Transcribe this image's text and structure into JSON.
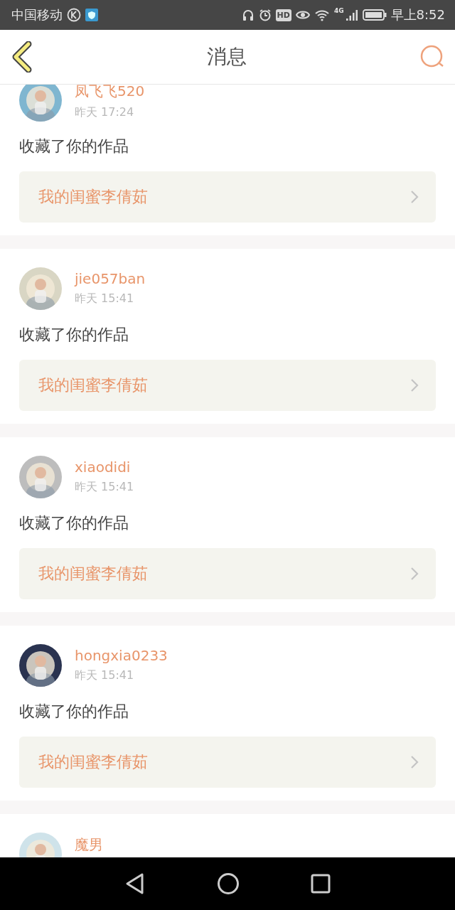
{
  "status_bar": {
    "carrier": "中国移动",
    "hd": "HD",
    "network": "4G",
    "time": "早上8:52"
  },
  "header": {
    "title": "消息"
  },
  "messages": [
    {
      "user": "凤飞飞520",
      "time": "昨天 17:24",
      "action": "收藏了你的作品",
      "work": "我的闺蜜李倩茹"
    },
    {
      "user": "jie057ban",
      "time": "昨天 15:41",
      "action": "收藏了你的作品",
      "work": "我的闺蜜李倩茹"
    },
    {
      "user": "xiaodidi",
      "time": "昨天 15:41",
      "action": "收藏了你的作品",
      "work": "我的闺蜜李倩茹"
    },
    {
      "user": "hongxia0233",
      "time": "昨天 15:41",
      "action": "收藏了你的作品",
      "work": "我的闺蜜李倩茹"
    },
    {
      "user": "魔男"
    }
  ]
}
